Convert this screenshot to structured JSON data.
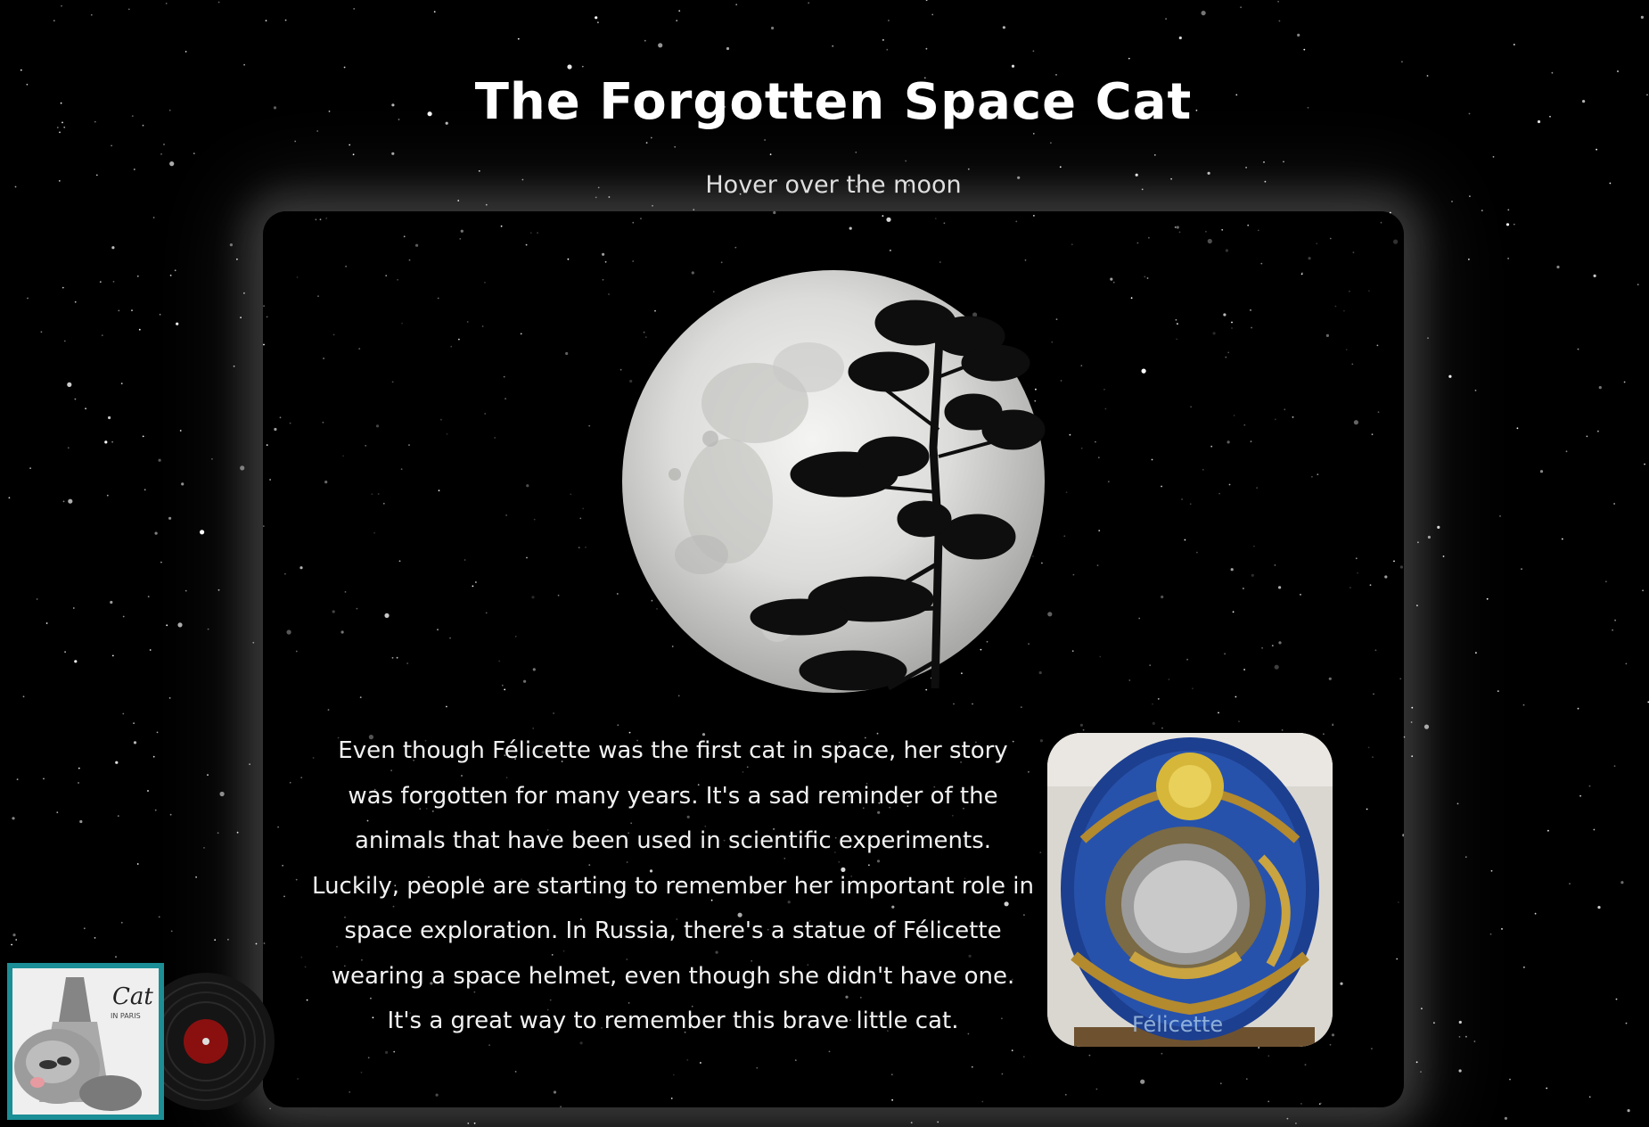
{
  "page": {
    "title": "The Forgotten Space Cat",
    "hint": "Hover over the moon"
  },
  "main": {
    "story": "Even though Félicette was the first cat in space, her story was forgotten for many years. It's a sad reminder of the animals that have been used in scientific experiments. Luckily, people are starting to remember her important role in space exploration. In Russia, there's a statue of Félicette wearing a space helmet, even though she didn't have one. It's a great way to remember this brave little cat.",
    "moon_icon": "moon-with-tree-silhouette",
    "statue_icon": "felicette-mosaic-statue",
    "statue_label": "Félicette"
  },
  "player": {
    "album_title": "Cat",
    "album_subtitle": "IN PARIS",
    "album_icon": "cat-album-cover",
    "record_icon": "vinyl-record"
  },
  "colors": {
    "background": "#000000",
    "accent": "#1b8e96",
    "record_label": "#8a1010"
  }
}
